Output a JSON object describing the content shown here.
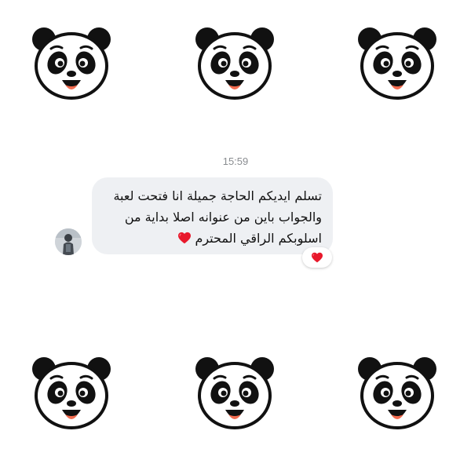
{
  "conversation": {
    "timestamp": "15:59",
    "message": {
      "lines": [
        "تسلم ايديكم الحاجة جميلة انا فتحت لعبة",
        "والجواب باين من عنوانه اصلا بداية من",
        "اسلوبكم الراقي المحترم"
      ],
      "inline_emoji": "red-heart-emoji"
    },
    "reaction": {
      "emoji": "red-heart-emoji",
      "color": "#e8192c"
    },
    "sender_avatar": "user-avatar-photo"
  },
  "background_stickers": {
    "icon": "panda-face-icon",
    "count": 6
  },
  "colors": {
    "bubble_background": "#eef0f3",
    "timestamp_text": "#8a8d91",
    "heart": "#e8192c",
    "panda_tongue": "#f26b4f"
  }
}
